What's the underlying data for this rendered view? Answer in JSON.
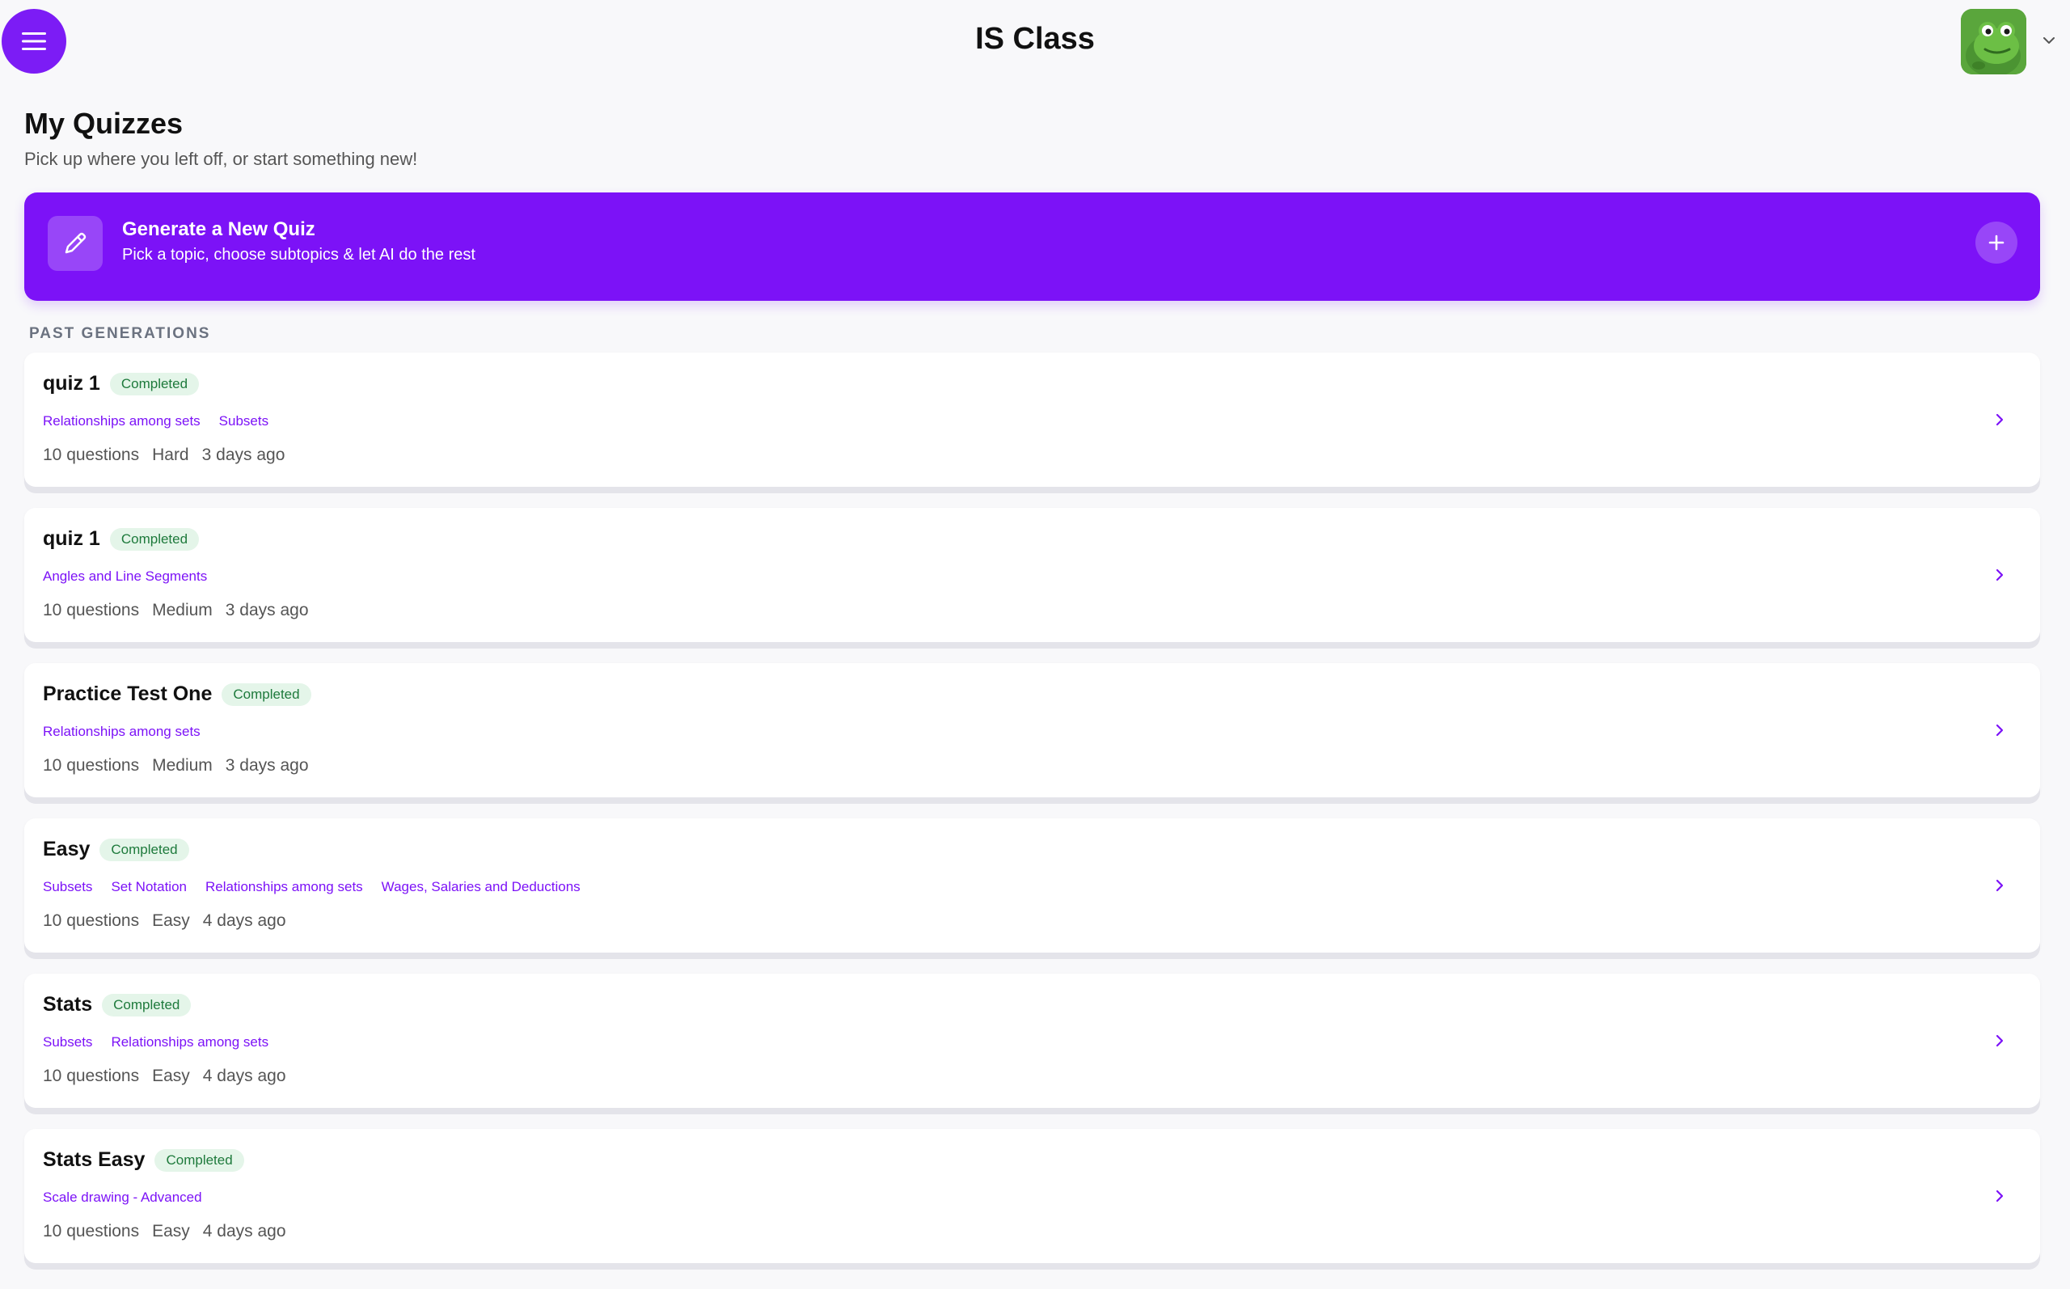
{
  "header": {
    "title": "IS Class",
    "menu_icon": "hamburger-icon",
    "avatar_icon": "frog-avatar",
    "caret_icon": "chevron-down-icon"
  },
  "page": {
    "title": "My Quizzes",
    "subtitle": "Pick up where you left off, or start something new!"
  },
  "generate": {
    "title": "Generate a New Quiz",
    "subtitle": "Pick a topic, choose subtopics & let AI do the rest",
    "icon": "pencil-icon",
    "action_icon": "plus-icon"
  },
  "section_label": "PAST GENERATIONS",
  "quizzes": [
    {
      "title": "quiz 1",
      "status": "Completed",
      "tags": [
        "Relationships among sets",
        "Subsets"
      ],
      "questions": "10 questions",
      "difficulty": "Hard",
      "when": "3 days ago"
    },
    {
      "title": "quiz 1",
      "status": "Completed",
      "tags": [
        "Angles and Line Segments"
      ],
      "questions": "10 questions",
      "difficulty": "Medium",
      "when": "3 days ago"
    },
    {
      "title": "Practice Test One",
      "status": "Completed",
      "tags": [
        "Relationships among sets"
      ],
      "questions": "10 questions",
      "difficulty": "Medium",
      "when": "3 days ago"
    },
    {
      "title": "Easy",
      "status": "Completed",
      "tags": [
        "Subsets",
        "Set Notation",
        "Relationships among sets",
        "Wages, Salaries and Deductions"
      ],
      "questions": "10 questions",
      "difficulty": "Easy",
      "when": "4 days ago"
    },
    {
      "title": "Stats",
      "status": "Completed",
      "tags": [
        "Subsets",
        "Relationships among sets"
      ],
      "questions": "10 questions",
      "difficulty": "Easy",
      "when": "4 days ago"
    },
    {
      "title": "Stats Easy",
      "status": "Completed",
      "tags": [
        "Scale drawing - Advanced"
      ],
      "questions": "10 questions",
      "difficulty": "Easy",
      "when": "4 days ago"
    }
  ],
  "colors": {
    "accent": "#7c12f7",
    "badge_bg": "#e4f5e9",
    "badge_text": "#1e7a3c"
  }
}
